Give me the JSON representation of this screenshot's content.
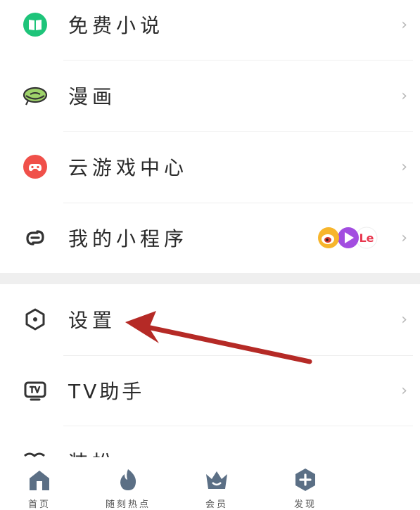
{
  "menu": {
    "items": [
      {
        "label": "免费小说",
        "icon": "book-icon"
      },
      {
        "label": "漫画",
        "icon": "comic-icon"
      },
      {
        "label": "云游戏中心",
        "icon": "game-controller-icon"
      },
      {
        "label": "我的小程序",
        "icon": "link-icon"
      },
      {
        "label": "设置",
        "icon": "settings-icon"
      },
      {
        "label": "TV助手",
        "icon": "tv-icon"
      },
      {
        "label": "装扮",
        "icon": "outfit-icon"
      }
    ],
    "chevron": "›",
    "mini_program_badges": [
      "weibo-icon",
      "play-icon",
      "le-icon"
    ],
    "badge_le_text": "Le"
  },
  "tabbar": {
    "items": [
      {
        "label": "首页",
        "icon": "home-icon"
      },
      {
        "label": "随刻热点",
        "icon": "flame-icon"
      },
      {
        "label": "会员",
        "icon": "crown-icon"
      },
      {
        "label": "发现",
        "icon": "discover-icon"
      }
    ]
  },
  "colors": {
    "novel_green": "#1ec47a",
    "game_red": "#f0504a",
    "annotation_arrow": "#b52a26",
    "tab_icon": "#5b6f85"
  }
}
